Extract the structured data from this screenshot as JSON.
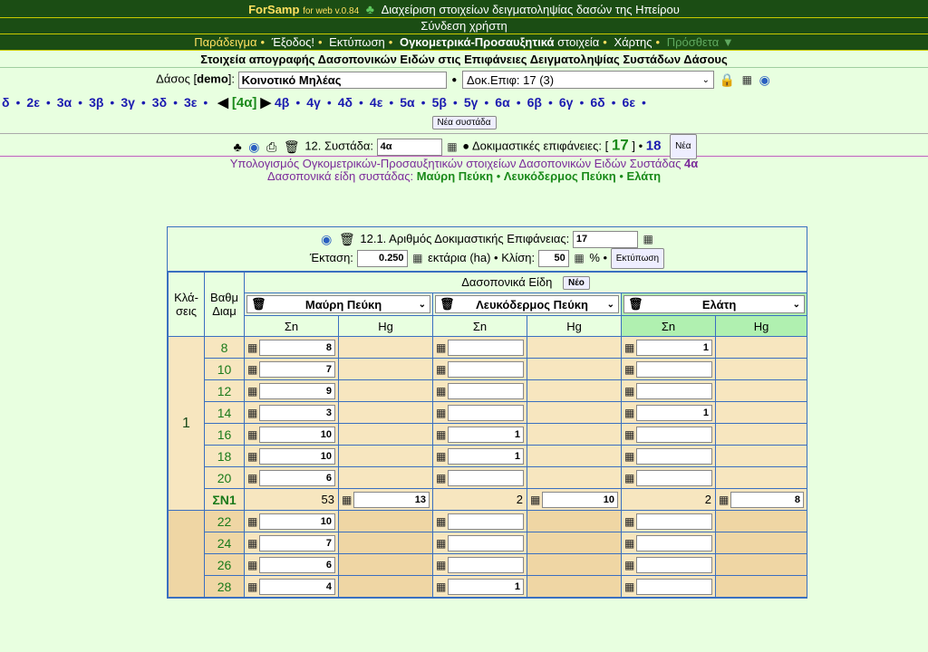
{
  "header": {
    "brand": "ForSamp",
    "version": "for web v.0.84",
    "title": "Διαχείριση στοιχείων δειγματοληψίας δασών της Ηπείρου",
    "login": "Σύνδεση χρήστη"
  },
  "menu": {
    "example": "Παράδειγμα",
    "exit": "Έξοδος!",
    "print": "Εκτύπωση",
    "volumetric": "Ογκομετρικά-Προσαυξητικά",
    "volumetric_suffix": "στοιχεία",
    "map": "Χάρτης",
    "extra": "Πρόσθετα ▼"
  },
  "page_title": "Στοιχεία απογραφής Δασοπονικών Ειδών στις Επιφάνειες Δειγματοληψίας Συστάδων Δάσους",
  "forest": {
    "label_prefix": "Δάσος [",
    "label_demo": "demo",
    "label_suffix": "]:",
    "value": "Κοινοτικό Μηλέας",
    "plot_select": "Δοκ.Επιφ: 17 (3)"
  },
  "stands_nav": {
    "left": [
      "δ",
      "2ε",
      "3α",
      "3β",
      "3γ",
      "3δ",
      "3ε"
    ],
    "current": "[4α]",
    "right": [
      "4β",
      "4γ",
      "4δ",
      "4ε",
      "5α",
      "5β",
      "5γ",
      "6α",
      "6β",
      "6γ",
      "6δ",
      "6ε"
    ],
    "new_stand": "Νέα συστάδα"
  },
  "plot_bar": {
    "stand_label": "12. Συστάδα:",
    "stand_value": "4α",
    "plots_label": "● Δοκιμαστικές επιφάνειες: [",
    "plot_current": "17",
    "plots_close": "] •",
    "plot_count": "18",
    "new_btn": "Νέα"
  },
  "calc": {
    "line1": "Υπολογισμός Ογκομετρικών-Προσαυξητικών στοιχείων Δασοπονικών Ειδών Συστάδας",
    "stand": "4α",
    "line2": "Δασοπονικά είδη συστάδας:",
    "species": [
      "Μαύρη Πεύκη",
      "Λευκόδερμος Πεύκη",
      "Ελάτη"
    ]
  },
  "panel": {
    "plot_number_label": "12.1. Αριθμός Δοκιμαστικής Επιφάνειας:",
    "plot_number": "17",
    "area_label": "Έκταση:",
    "area_value": "0.250",
    "area_unit": "εκτάρια (ha)  •  Κλίση:",
    "slope_value": "50",
    "slope_unit": "%  •",
    "print_btn": "Εκτύπωση",
    "col_classes": "Κλά-σεις",
    "col_diam": "Βαθμ Διαμ",
    "species_header": "Δασοπονικά Είδη",
    "new_species_btn": "Νέο",
    "sub_n": "Σn",
    "sub_hg": "Hg",
    "species": [
      "Μαύρη Πεύκη",
      "Λευκόδερμος Πεύκη",
      "Ελάτη"
    ]
  },
  "class1": {
    "label": "1",
    "rows": [
      {
        "d": "8",
        "v": [
          "8",
          "",
          "1"
        ]
      },
      {
        "d": "10",
        "v": [
          "7",
          "",
          ""
        ]
      },
      {
        "d": "12",
        "v": [
          "9",
          "",
          ""
        ]
      },
      {
        "d": "14",
        "v": [
          "3",
          "",
          "1"
        ]
      },
      {
        "d": "16",
        "v": [
          "10",
          "1",
          ""
        ]
      },
      {
        "d": "18",
        "v": [
          "10",
          "1",
          ""
        ]
      },
      {
        "d": "20",
        "v": [
          "6",
          "",
          ""
        ]
      }
    ],
    "sum": {
      "label": "ΣΝ1",
      "n": [
        "53",
        "2",
        "2"
      ],
      "hg": [
        "13",
        "10",
        "8"
      ]
    }
  },
  "class2": {
    "rows": [
      {
        "d": "22",
        "v": [
          "10",
          "",
          ""
        ]
      },
      {
        "d": "24",
        "v": [
          "7",
          "",
          ""
        ]
      },
      {
        "d": "26",
        "v": [
          "6",
          "",
          ""
        ]
      },
      {
        "d": "28",
        "v": [
          "4",
          "1",
          ""
        ]
      }
    ]
  }
}
